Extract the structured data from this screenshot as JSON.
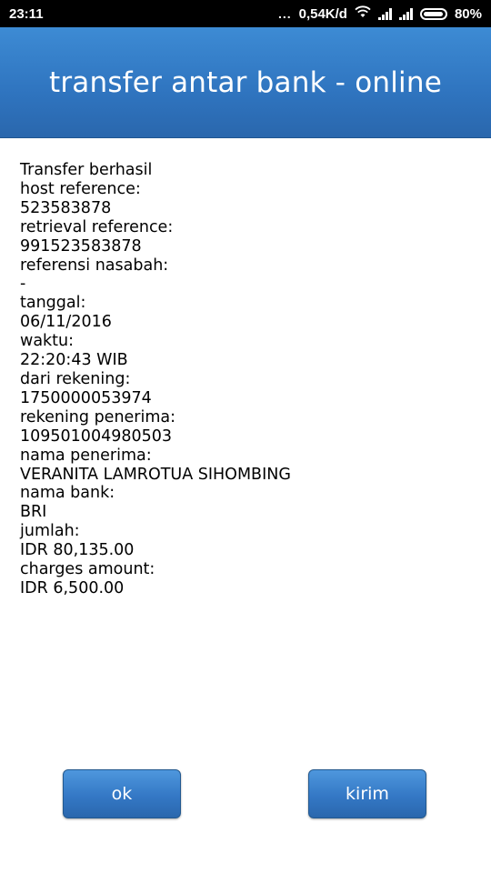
{
  "status_bar": {
    "time": "23:11",
    "dots": "...",
    "network_speed": "0,54K/d",
    "battery": "80%",
    "icons": [
      "wifi-icon",
      "signal-icon",
      "signal-icon",
      "battery-icon"
    ]
  },
  "header": {
    "title": "transfer antar bank - online"
  },
  "receipt": {
    "lines": [
      "Transfer berhasil",
      "host reference:",
      "523583878",
      "retrieval reference:",
      "991523583878",
      "referensi nasabah:",
      "-",
      "tanggal:",
      "06/11/2016",
      "waktu:",
      "22:20:43 WIB",
      "dari rekening:",
      "1750000053974",
      "rekening penerima:",
      "109501004980503",
      "nama penerima:",
      "VERANITA LAMROTUA SIHOMBING",
      "nama bank:",
      "BRI",
      "jumlah:",
      "IDR 80,135.00",
      "charges amount:",
      "IDR 6,500.00"
    ]
  },
  "buttons": {
    "ok_label": "ok",
    "kirim_label": "kirim"
  },
  "colors": {
    "header_blue": "#2f74bf",
    "button_blue": "#3478c5",
    "status_bar": "#000000"
  }
}
